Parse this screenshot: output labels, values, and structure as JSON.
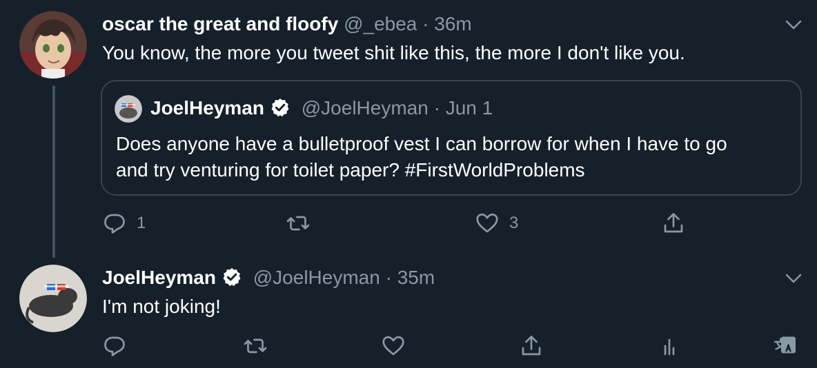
{
  "colors": {
    "background": "#15202b",
    "secondary_text": "#8899a6",
    "border": "#38444d",
    "thread_line": "#3d5466",
    "verified": "#ffffff"
  },
  "tweet1": {
    "name": "oscar the great and floofy",
    "handle": "@_ebea",
    "separator": "·",
    "time": "36m",
    "text": "You know, the more you tweet shit like this, the more I don't like you.",
    "quoted": {
      "name": "JoelHeyman",
      "handle": "@JoelHeyman",
      "separator": "·",
      "time": "Jun 1",
      "text_line1": "Does anyone have a bulletproof vest I can borrow for when I have to go",
      "text_line2": "and try venturing for toilet paper?  #FirstWorldProblems"
    },
    "actions": {
      "reply_count": "1",
      "retweet_count": "",
      "like_count": "3"
    },
    "icons": [
      "chevron-down-icon",
      "reply-icon",
      "retweet-icon",
      "like-icon",
      "share-icon",
      "verified-badge-icon"
    ]
  },
  "tweet2": {
    "name": "JoelHeyman",
    "handle": "@JoelHeyman",
    "separator": "·",
    "time": "35m",
    "text": "I'm not joking!",
    "icons": [
      "chevron-down-icon",
      "reply-icon",
      "retweet-icon",
      "like-icon",
      "share-icon",
      "analytics-icon",
      "translate-icon",
      "verified-badge-icon"
    ]
  }
}
